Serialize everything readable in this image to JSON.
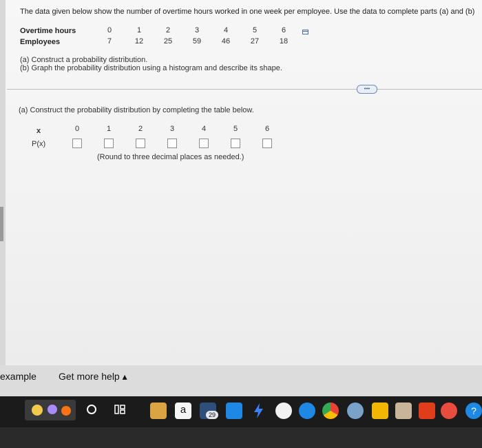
{
  "intro": {
    "text": "The data given below show the number of overtime hours worked in one week per employee. Use the data to complete parts (a) and (b)"
  },
  "data_table": {
    "hours_label": "Overtime hours",
    "employees_label": "Employees",
    "hours": [
      "0",
      "1",
      "2",
      "3",
      "4",
      "5",
      "6"
    ],
    "employees": [
      "7",
      "12",
      "25",
      "59",
      "46",
      "27",
      "18"
    ]
  },
  "parts": {
    "a": "(a) Construct a probability distribution.",
    "b": "(b) Graph the probability distribution using a histogram and describe its shape."
  },
  "more_button": {
    "label": "•••"
  },
  "question": {
    "prompt": "(a) Construct the probability distribution by completing the table below.",
    "x_label": "x",
    "px_label": "P(x)",
    "x_values": [
      "0",
      "1",
      "2",
      "3",
      "4",
      "5",
      "6"
    ],
    "px_values": [
      "",
      "",
      "",
      "",
      "",
      "",
      ""
    ],
    "round_note": "(Round to three decimal places as needed.)"
  },
  "bottom": {
    "example_label": "example",
    "help_label": "Get more help ▴"
  },
  "taskbar": {
    "search_icon": "circle-search-icon",
    "task_view_icon": "task-view-icon",
    "calendar_badge": "29"
  },
  "colors": {
    "taskbar": "#1b1b1b",
    "accent_blue": "#1e88e5"
  }
}
